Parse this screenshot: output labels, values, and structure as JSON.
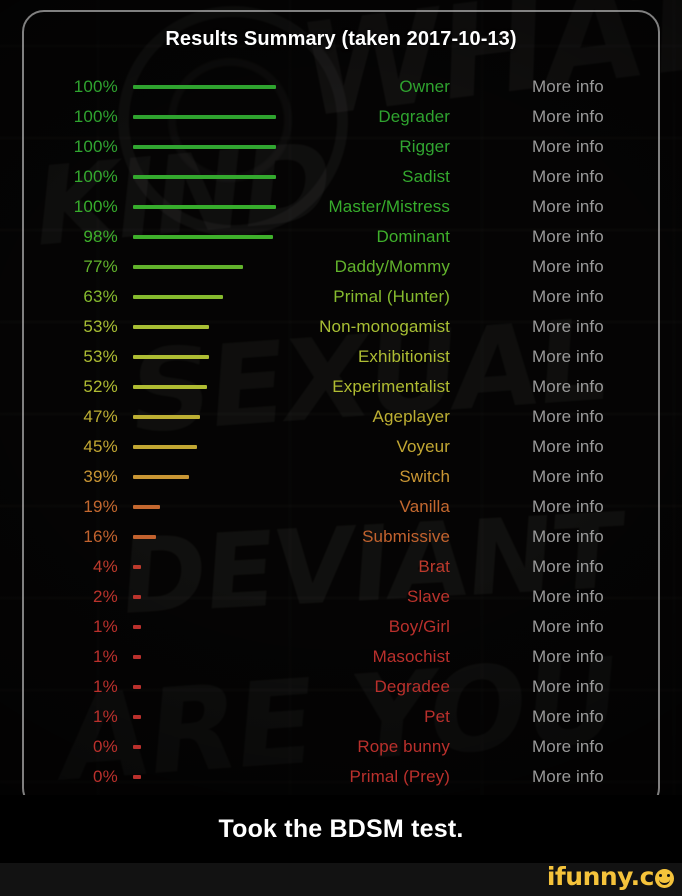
{
  "card": {
    "title": "Results Summary (taken 2017-10-13)"
  },
  "background": {
    "graffiti_words": [
      "WHAT",
      "KIND",
      "SEXUAL",
      "DEVIANT",
      "ARE YOU"
    ]
  },
  "table": {
    "more_info_label": "More info",
    "rows": [
      {
        "percent": "100%",
        "value": 100,
        "label": "Owner",
        "color": "#2fa32f",
        "more": "More info"
      },
      {
        "percent": "100%",
        "value": 100,
        "label": "Degrader",
        "color": "#2fa32f",
        "more": "More info"
      },
      {
        "percent": "100%",
        "value": 100,
        "label": "Rigger",
        "color": "#31a531",
        "more": "More info"
      },
      {
        "percent": "100%",
        "value": 100,
        "label": "Sadist",
        "color": "#34a92e",
        "more": "More info"
      },
      {
        "percent": "100%",
        "value": 100,
        "label": "Master/Mistress",
        "color": "#37ad2c",
        "more": "More info"
      },
      {
        "percent": "98%",
        "value": 98,
        "label": "Dominant",
        "color": "#3fb02b",
        "more": "More info"
      },
      {
        "percent": "77%",
        "value": 77,
        "label": "Daddy/Mommy",
        "color": "#62b32c",
        "more": "More info"
      },
      {
        "percent": "63%",
        "value": 63,
        "label": "Primal (Hunter)",
        "color": "#86bb2e",
        "more": "More info"
      },
      {
        "percent": "53%",
        "value": 53,
        "label": "Non-monogamist",
        "color": "#a8bf34",
        "more": "More info"
      },
      {
        "percent": "53%",
        "value": 53,
        "label": "Exhibitionist",
        "color": "#aebd33",
        "more": "More info"
      },
      {
        "percent": "52%",
        "value": 52,
        "label": "Experimentalist",
        "color": "#b0bc32",
        "more": "More info"
      },
      {
        "percent": "47%",
        "value": 47,
        "label": "Ageplayer",
        "color": "#bdaf33",
        "more": "More info"
      },
      {
        "percent": "45%",
        "value": 45,
        "label": "Voyeur",
        "color": "#c2a733",
        "more": "More info"
      },
      {
        "percent": "39%",
        "value": 39,
        "label": "Switch",
        "color": "#c99634",
        "more": "More info"
      },
      {
        "percent": "19%",
        "value": 19,
        "label": "Vanilla",
        "color": "#c4682f",
        "more": "More info"
      },
      {
        "percent": "16%",
        "value": 16,
        "label": "Submissive",
        "color": "#c2622e",
        "more": "More info"
      },
      {
        "percent": "4%",
        "value": 4,
        "label": "Brat",
        "color": "#bd3a2c",
        "more": "More info"
      },
      {
        "percent": "2%",
        "value": 2,
        "label": "Slave",
        "color": "#bb332c",
        "more": "More info"
      },
      {
        "percent": "1%",
        "value": 1,
        "label": "Boy/Girl",
        "color": "#ba302c",
        "more": "More info"
      },
      {
        "percent": "1%",
        "value": 1,
        "label": "Masochist",
        "color": "#ba302c",
        "more": "More info"
      },
      {
        "percent": "1%",
        "value": 1,
        "label": "Degradee",
        "color": "#ba302c",
        "more": "More info"
      },
      {
        "percent": "1%",
        "value": 1,
        "label": "Pet",
        "color": "#ba302c",
        "more": "More info"
      },
      {
        "percent": "0%",
        "value": 0,
        "label": "Rope bunny",
        "color": "#ba302c",
        "more": "More info"
      },
      {
        "percent": "0%",
        "value": 0,
        "label": "Primal (Prey)",
        "color": "#ba302c",
        "more": "More info"
      }
    ]
  },
  "caption": {
    "text": "Took the BDSM test."
  },
  "watermark": {
    "text": "ifunny.c",
    "icon": "smiley-face-icon",
    "color": "#f5c33b"
  },
  "chart_data": {
    "type": "bar",
    "title": "Results Summary (taken 2017-10-13)",
    "xlabel": "",
    "ylabel": "",
    "xlim": [
      0,
      100
    ],
    "orientation": "horizontal",
    "grid": false,
    "legend": null,
    "categories": [
      "Owner",
      "Degrader",
      "Rigger",
      "Sadist",
      "Master/Mistress",
      "Dominant",
      "Daddy/Mommy",
      "Primal (Hunter)",
      "Non-monogamist",
      "Exhibitionist",
      "Experimentalist",
      "Ageplayer",
      "Voyeur",
      "Switch",
      "Vanilla",
      "Submissive",
      "Brat",
      "Slave",
      "Boy/Girl",
      "Masochist",
      "Degradee",
      "Pet",
      "Rope bunny",
      "Primal (Prey)"
    ],
    "values": [
      100,
      100,
      100,
      100,
      100,
      98,
      77,
      63,
      53,
      53,
      52,
      47,
      45,
      39,
      19,
      16,
      4,
      2,
      1,
      1,
      1,
      1,
      0,
      0
    ],
    "value_labels": [
      "100%",
      "100%",
      "100%",
      "100%",
      "100%",
      "98%",
      "77%",
      "63%",
      "53%",
      "53%",
      "52%",
      "47%",
      "45%",
      "39%",
      "19%",
      "16%",
      "4%",
      "2%",
      "1%",
      "1%",
      "1%",
      "1%",
      "0%",
      "0%"
    ]
  }
}
